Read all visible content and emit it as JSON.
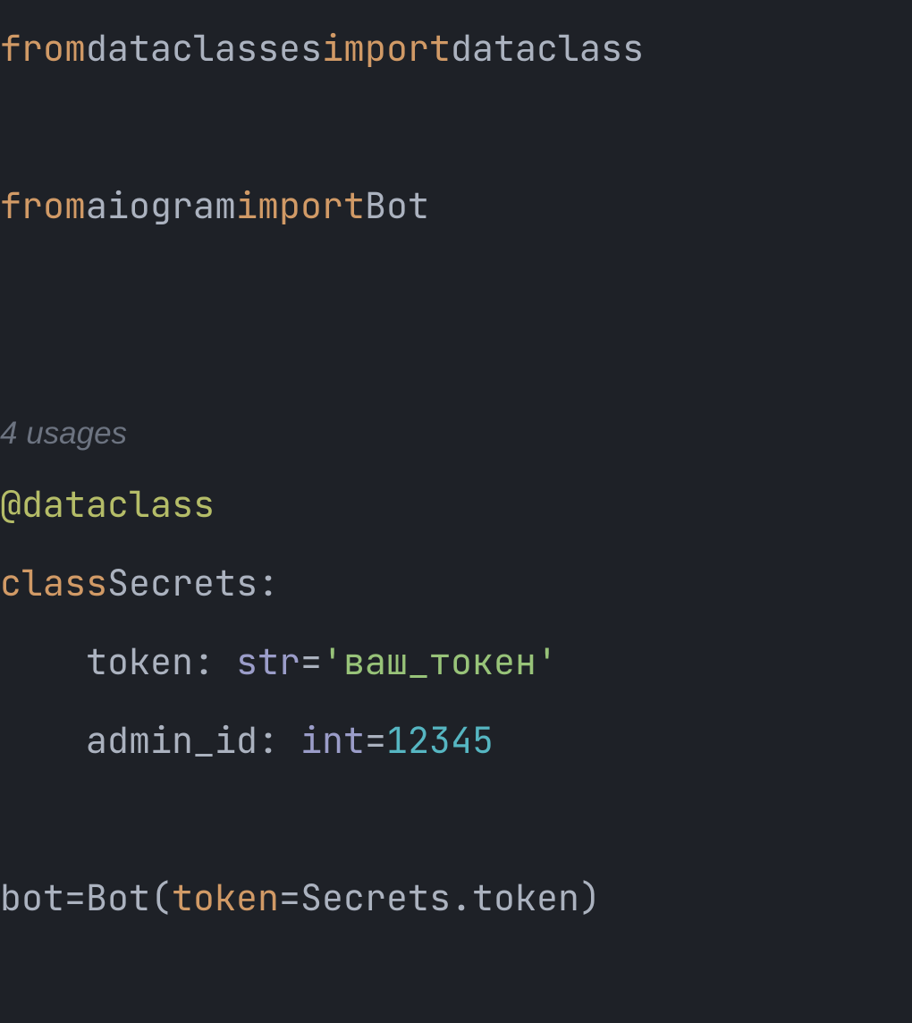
{
  "code": {
    "line1": {
      "from": "from",
      "module": "dataclasses",
      "import": "import",
      "name": "dataclass"
    },
    "line2": {
      "from": "from",
      "module": "aiogram",
      "import": "import",
      "name": "Bot"
    },
    "usages_hint": "4 usages",
    "decorator": "@dataclass",
    "class_keyword": "class",
    "class_name": "Secrets",
    "colon": ":",
    "field1": {
      "name": "token",
      "type": "str",
      "equals": "=",
      "value": "'ваш_токен'"
    },
    "field2": {
      "name": "admin_id",
      "type": "int",
      "equals": "=",
      "value": "12345"
    },
    "assignment": {
      "var": "bot",
      "equals": "=",
      "call": "Bot",
      "open_paren": "(",
      "param": "token",
      "param_equals": "=",
      "arg_obj": "Secrets",
      "dot": ".",
      "arg_attr": "token",
      "close_paren": ")"
    }
  }
}
